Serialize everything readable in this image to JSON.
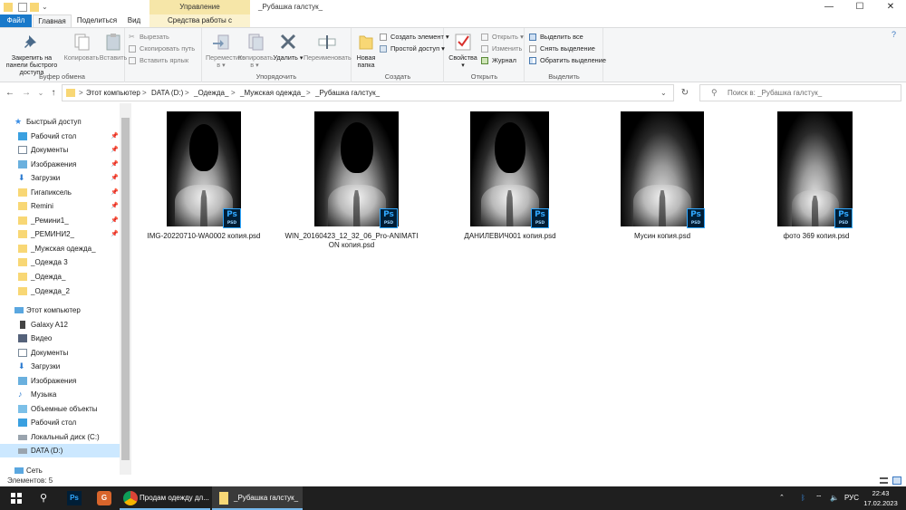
{
  "titlebar": {
    "context_tab_header": "Управление",
    "window_title": "_Рубашка галстук_",
    "buttons": {
      "minimize": "—",
      "maximize": "☐",
      "close": "✕"
    }
  },
  "tabs": {
    "file": "Файл",
    "home": "Главная",
    "share": "Поделиться",
    "view": "Вид",
    "picture_tools": "Средства работы с рисунками"
  },
  "ribbon": {
    "clipboard": {
      "label": "Буфер обмена",
      "pin": "Закрепить на панели быстрого доступа",
      "copy": "Копировать",
      "paste": "Вставить",
      "cut": "Вырезать",
      "copy_path": "Скопировать путь",
      "paste_shortcut": "Вставить ярлык"
    },
    "organize": {
      "label": "Упорядочить",
      "move_to": "Переместить в ▾",
      "copy_to": "Копировать в ▾",
      "delete": "Удалить ▾",
      "rename": "Переименовать"
    },
    "new": {
      "label": "Создать",
      "new_folder": "Новая папка",
      "new_item": "Создать элемент ▾",
      "easy_access": "Простой доступ ▾"
    },
    "open": {
      "label": "Открыть",
      "properties": "Свойства ▾",
      "open": "Открыть ▾",
      "edit": "Изменить",
      "history": "Журнал"
    },
    "select": {
      "label": "Выделить",
      "select_all": "Выделить все",
      "select_none": "Снять выделение",
      "invert": "Обратить выделение"
    }
  },
  "address": {
    "nav": {
      "back": "←",
      "forward": "→",
      "recent": "⌄",
      "up": "↑"
    },
    "crumbs": [
      "Этот компьютер",
      "DATA (D:)",
      "_Одежда_",
      "_Мужская одежда_",
      "_Рубашка галстук_"
    ],
    "separator": ">",
    "search_placeholder": "Поиск в: _Рубашка галстук_"
  },
  "sidebar": {
    "quick_access": "Быстрый доступ",
    "pinned": [
      {
        "label": "Рабочий стол",
        "pinned": true
      },
      {
        "label": "Документы",
        "pinned": true
      },
      {
        "label": "Изображения",
        "pinned": true
      },
      {
        "label": "Загрузки",
        "pinned": true
      },
      {
        "label": "Гигапиксель",
        "pinned": true
      },
      {
        "label": "Remini",
        "pinned": true
      },
      {
        "label": "_Ремини1_",
        "pinned": true
      },
      {
        "label": "_РЕМИНИ2_",
        "pinned": true
      },
      {
        "label": "_Мужская одежда_",
        "pinned": false
      },
      {
        "label": "_Одежда 3",
        "pinned": false
      },
      {
        "label": "_Одежда_",
        "pinned": false
      },
      {
        "label": "_Одежда_2",
        "pinned": false
      }
    ],
    "this_pc": "Этот компьютер",
    "pc_items": [
      {
        "label": "Galaxy A12"
      },
      {
        "label": "Видео"
      },
      {
        "label": "Документы"
      },
      {
        "label": "Загрузки"
      },
      {
        "label": "Изображения"
      },
      {
        "label": "Музыка"
      },
      {
        "label": "Объемные объекты"
      },
      {
        "label": "Рабочий стол"
      },
      {
        "label": "Локальный диск (C:)"
      },
      {
        "label": "DATA (D:)"
      }
    ],
    "network": "Сеть"
  },
  "files": [
    {
      "name": "IMG-20220710-WA0002 копия.psd",
      "head": true
    },
    {
      "name": "WIN_20160423_12_32_06_Pro-ANIMATION копия.psd",
      "head": true
    },
    {
      "name": "ДАНИЛЕВИЧ001 копия.psd",
      "head": true
    },
    {
      "name": "Мусин копия.psd",
      "head": false
    },
    {
      "name": "фото 369 копия.psd",
      "head": false
    }
  ],
  "ps_badge": {
    "ps": "Ps",
    "psd": "PSD"
  },
  "status": {
    "items": "Элементов: 5"
  },
  "taskbar": {
    "apps": [
      {
        "label": "Продам одежду дл..."
      },
      {
        "label": "_Рубашка галстук_"
      }
    ],
    "language": "РУС",
    "time": "22:43",
    "date": "17.02.2023"
  },
  "colors": {
    "accent": "#1979ca",
    "selected": "#cce8ff",
    "folder": "#f8d775",
    "taskbar": "#1f1f1f"
  }
}
